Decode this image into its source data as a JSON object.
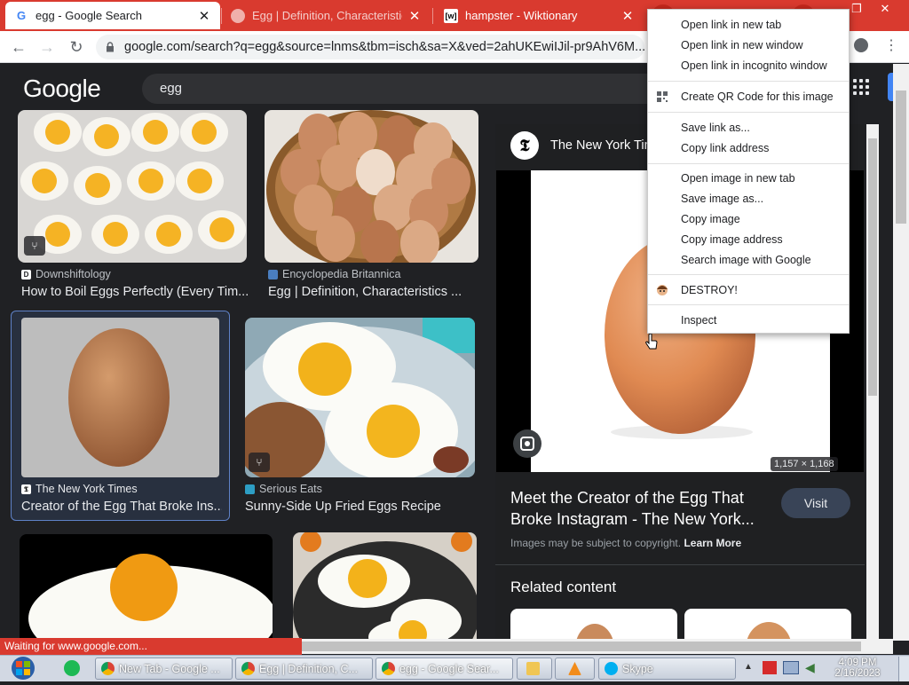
{
  "tabs": [
    {
      "title": "egg - Google Search",
      "favicon": "google-g-icon"
    },
    {
      "title": "Egg | Definition, Characteristics",
      "favicon": "britannica-icon"
    },
    {
      "title": "hampster - Wiktionary",
      "favicon": "wiktionary-icon"
    }
  ],
  "window_controls": {
    "minimize": "—",
    "maximize": "❐",
    "close": "✕"
  },
  "address": {
    "url": "google.com/search?q=egg&source=lnms&tbm=isch&sa=X&ved=2ahUKEwiIJil-pr9AhV6M..."
  },
  "google": {
    "logo": "Google",
    "query": "egg"
  },
  "results": [
    {
      "source": "Downshiftology",
      "title": "How to Boil Eggs Perfectly (Every Tim..."
    },
    {
      "source": "Encyclopedia Britannica",
      "title": "Egg | Definition, Characteristics ..."
    },
    {
      "source": "The New York Times",
      "title": "Creator of the Egg That Broke Ins..."
    },
    {
      "source": "Serious Eats",
      "title": "Sunny-Side Up Fried Eggs Recipe"
    }
  ],
  "panel": {
    "source": "The New York Tim",
    "dims": "1,157 × 1,168",
    "title": "Meet the Creator of the Egg That Broke Instagram - The New York...",
    "visit": "Visit",
    "copyright": "Images may be subject to copyright.",
    "learn_more": "Learn More",
    "related": "Related content"
  },
  "context_menu": [
    "Open link in new tab",
    "Open link in new window",
    "Open link in incognito window",
    "Create QR Code for this image",
    "Save link as...",
    "Copy link address",
    "Open image in new tab",
    "Save image as...",
    "Copy image",
    "Copy image address",
    "Search image with Google",
    "DESTROY!",
    "Inspect"
  ],
  "status": "Waiting for www.google.com...",
  "taskbar": {
    "items": [
      "New Tab - Google ...",
      "Egg | Definition, C...",
      "egg - Google Sear...",
      "",
      "",
      "Skype"
    ],
    "time": "4:09 PM",
    "date": "2/16/2023"
  },
  "colors": {
    "accent": "#d93a2f",
    "dark_bg": "#202124",
    "panel": "#1f2022",
    "visit_btn": "#394457"
  }
}
